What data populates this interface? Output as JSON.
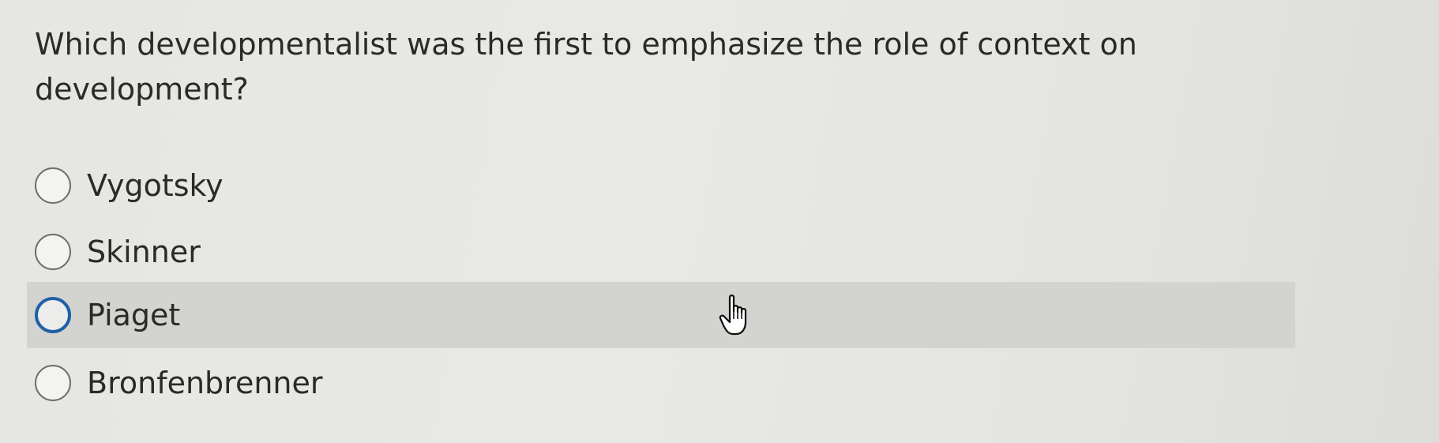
{
  "question": {
    "text": "Which developmentalist was the first to emphasize the role of context on development?"
  },
  "options": [
    {
      "label": "Vygotsky",
      "selected": false,
      "hovered": false
    },
    {
      "label": "Skinner",
      "selected": false,
      "hovered": false
    },
    {
      "label": "Piaget",
      "selected": false,
      "hovered": true
    },
    {
      "label": "Bronfenbrenner",
      "selected": false,
      "hovered": false
    }
  ],
  "colors": {
    "hover_background": "#d3d3cf",
    "focus_ring": "#1f5fa8",
    "page_background": "#e6e6e2",
    "text": "#2a2a2a"
  },
  "cursor": {
    "icon": "hand-pointer-icon"
  }
}
